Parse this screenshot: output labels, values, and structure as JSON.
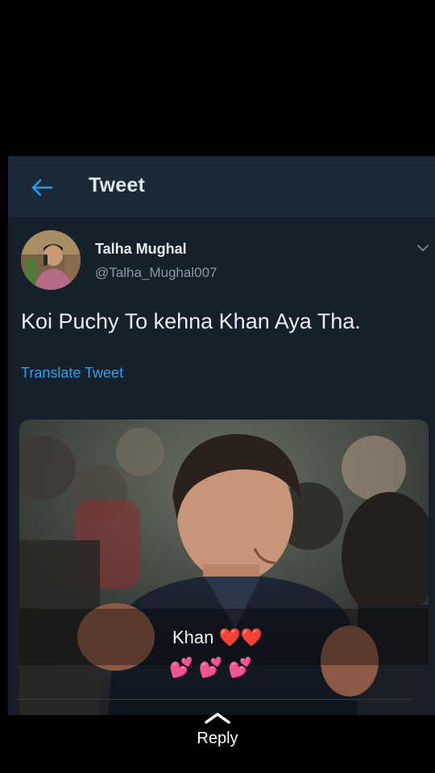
{
  "header": {
    "title": "Tweet",
    "back_icon": "arrow-left-icon",
    "accent_color": "#1da1f2"
  },
  "tweet": {
    "author_name": "Talha Mughal",
    "author_handle": "@Talha_Mughal007",
    "text": "Koi Puchy To kehna Khan Aya Tha.",
    "translate_label": "Translate Tweet",
    "caret_icon": "chevron-down-icon",
    "media": {
      "caption_line1": "Khan ❤️❤️",
      "caption_line2": "💕 💕 💕"
    }
  },
  "footer": {
    "reply_label": "Reply",
    "reply_icon": "chevron-up-icon"
  },
  "colors": {
    "background": "#000000",
    "panel": "#15202b",
    "link": "#2aa1f2",
    "secondary_text": "#8899a6"
  }
}
